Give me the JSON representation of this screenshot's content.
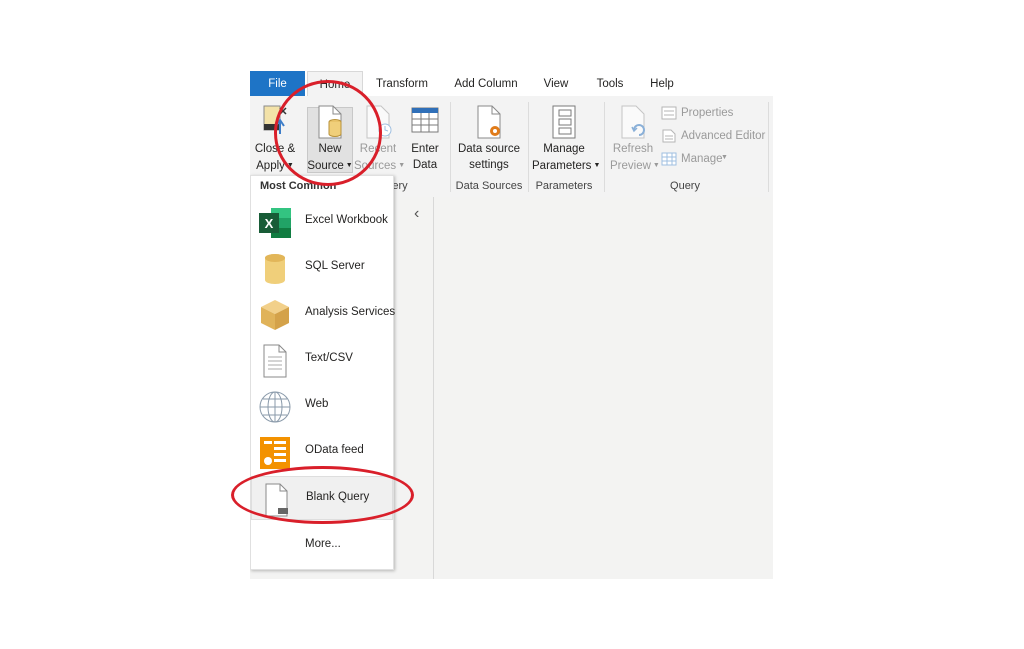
{
  "tabs": [
    "File",
    "Home",
    "Transform",
    "Add Column",
    "View",
    "Tools",
    "Help"
  ],
  "ribbon": {
    "close_apply": [
      "Close &",
      "Apply"
    ],
    "new_source": [
      "New",
      "Source"
    ],
    "recent_sources": [
      "Recent",
      "Sources"
    ],
    "enter_data": [
      "Enter",
      "Data"
    ],
    "data_source_settings": [
      "Data source",
      "settings"
    ],
    "manage_parameters": [
      "Manage",
      "Parameters"
    ],
    "refresh_preview": [
      "Refresh",
      "Preview"
    ],
    "properties": "Properties",
    "advanced_editor": "Advanced Editor",
    "manage": "Manage",
    "groups": {
      "new_query_partial": "ery",
      "data_sources": "Data Sources",
      "parameters": "Parameters",
      "query": "Query"
    }
  },
  "menu": {
    "header": "Most Common",
    "items": [
      "Excel Workbook",
      "SQL Server",
      "Analysis Services",
      "Text/CSV",
      "Web",
      "OData feed",
      "Blank Query"
    ],
    "more": "More..."
  },
  "colors": {
    "file_tab": "#1e74c6",
    "annotation_ring": "#d91f2a",
    "excel_green": "#1d6f42",
    "odata_orange": "#f39200"
  }
}
